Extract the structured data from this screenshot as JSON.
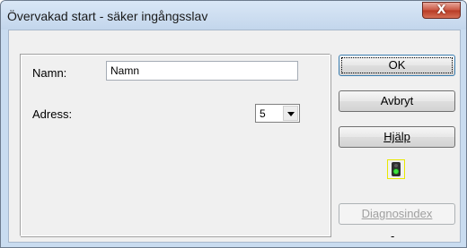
{
  "window": {
    "title": "Övervakad start - säker ingångsslav",
    "close_glyph": "X"
  },
  "form": {
    "name_label": "Namn:",
    "name_value": "Namn",
    "address_label": "Adress:",
    "address_value": "5"
  },
  "buttons": {
    "ok": "OK",
    "cancel": "Avbryt",
    "help": "Hjälp",
    "diagnostics": "Diagnosindex"
  },
  "status": {
    "icon": "status-indicator-icon",
    "dash": "-"
  }
}
